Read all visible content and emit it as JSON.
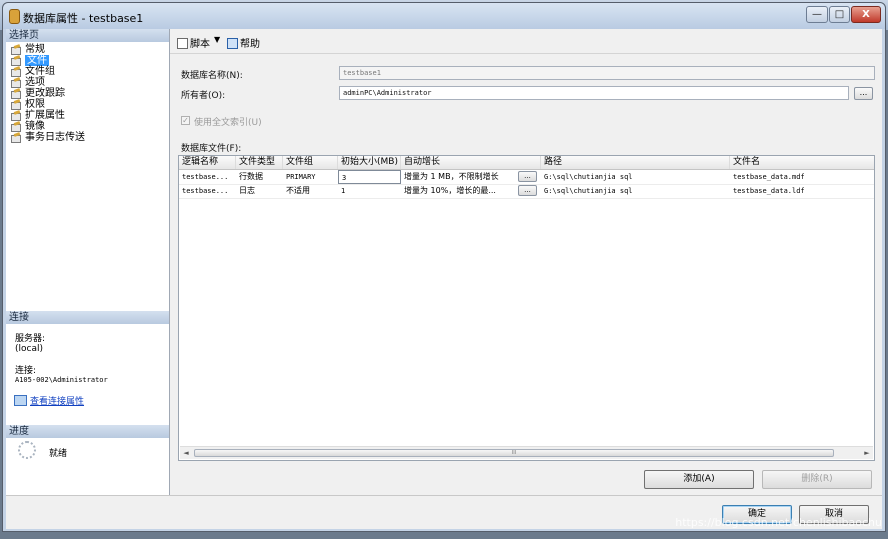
{
  "window": {
    "title": "数据库属性 - testbase1"
  },
  "left_pane": {
    "select_page_header": "选择页",
    "pages": [
      "常规",
      "文件",
      "文件组",
      "选项",
      "更改跟踪",
      "权限",
      "扩展属性",
      "镜像",
      "事务日志传送"
    ],
    "selected_page": "文件",
    "connection_header": "连接",
    "server_label": "服务器:",
    "server_value": "(local)",
    "connection_label": "连接:",
    "connection_value": "A105-002\\Administrator",
    "view_conn_link": "查看连接属性",
    "progress_header": "进度",
    "progress_status": "就绪"
  },
  "toolbar": {
    "script_label": "脚本",
    "script_arrow": "▼",
    "help_label": "帮助"
  },
  "form": {
    "dbname_label": "数据库名称(N):",
    "dbname_value": "testbase1",
    "owner_label": "所有者(O):",
    "owner_value": "adminPC\\Administrator",
    "browse_label": "...",
    "fulltext_label": "使用全文索引(U)",
    "fulltext_checked": true,
    "dbfiles_label": "数据库文件(F):"
  },
  "grid": {
    "columns": [
      "逻辑名称",
      "文件类型",
      "文件组",
      "初始大小(MB)",
      "自动增长",
      "路径",
      "文件名"
    ],
    "rows": [
      {
        "name": "testbase...",
        "type": "行数据",
        "group": "PRIMARY",
        "size": "3",
        "growth": "增量为 1 MB，不限制增长",
        "path": "G:\\sql\\chutianjia sql",
        "file": "testbase_data.mdf"
      },
      {
        "name": "testbase...",
        "type": "日志",
        "group": "不适用",
        "size": "1",
        "growth": "增量为 10%，增长的最...",
        "path": "G:\\sql\\chutianjia sql",
        "file": "testbase_data.ldf"
      }
    ],
    "cell_button": "...",
    "scroll_left": "◄",
    "scroll_right": "►",
    "scroll_grip": "III"
  },
  "buttons": {
    "add": "添加(A)",
    "remove": "删除(R)",
    "ok": "确定",
    "cancel": "取消"
  },
  "window_controls": {
    "minimize": "—",
    "maximize": "□",
    "close": "X"
  },
  "watermark": "https://blog.csdn.net/chenlishibaochu"
}
